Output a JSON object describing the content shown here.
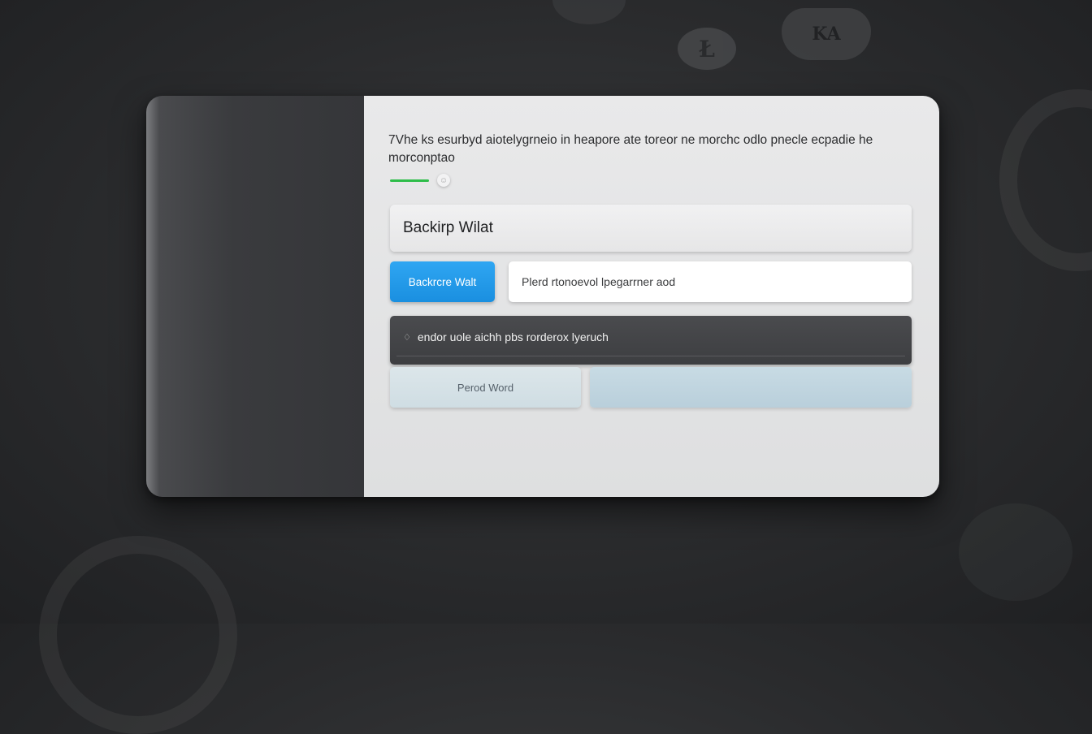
{
  "background": {
    "badge_left_glyph": "Ł",
    "badge_right_text": "KA"
  },
  "dialog": {
    "description": "7Vhe ks esurbyd aiotelygrneio in heapore ate toreor ne morchc odlo pnecle ecpadie he morconptao",
    "progress_fraction": 0.75,
    "spinner_glyph": "☺",
    "title_value": "Backirp Wilat",
    "primary_button_label": "Backrcre Walt",
    "input_placeholder": "Plerd rtonoevol lpegarrner aod",
    "info_bar_icon": "♢",
    "info_bar_text": "endor uole aichh pbs rorderox lyeruch",
    "secondary_button_label": "Perod Word"
  },
  "colors": {
    "primary_button": "#1a8fe0",
    "progress": "#2ebd4a",
    "info_bar": "#434447",
    "secondary_button": "#d4e0e5",
    "panel": "#bfd3dd"
  }
}
